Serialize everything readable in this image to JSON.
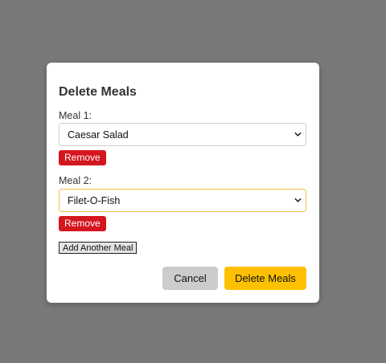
{
  "dialog": {
    "title": "Delete Meals",
    "meals": [
      {
        "label": "Meal 1:",
        "value": "Caesar Salad",
        "remove_label": "Remove"
      },
      {
        "label": "Meal 2:",
        "value": "Filet-O-Fish",
        "remove_label": "Remove"
      }
    ],
    "add_label": "Add Another Meal",
    "cancel_label": "Cancel",
    "delete_label": "Delete Meals"
  },
  "colors": {
    "overlay": "#7a7977",
    "remove": "#d4161f",
    "primary": "#fdc101",
    "secondary": "#cccccc",
    "focus_border": "#f2c04a"
  },
  "icons": {
    "select_arrow": "chevron-down-icon"
  }
}
